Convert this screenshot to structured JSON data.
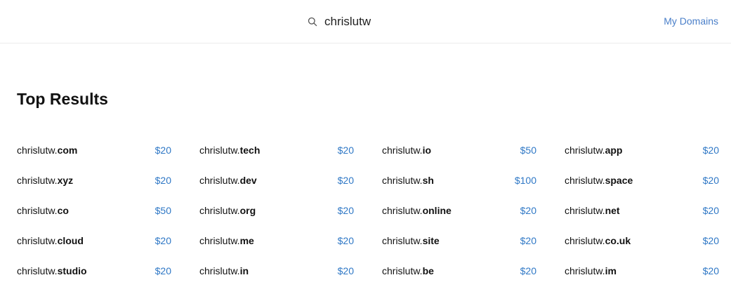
{
  "header": {
    "search_value": "chrislutw",
    "search_icon": "search-icon",
    "my_domains_label": "My Domains",
    "accent_color": "#2f78c6"
  },
  "section": {
    "title": "Top Results"
  },
  "results": [
    {
      "name": "chrislutw.",
      "tld": "com",
      "price": "$20"
    },
    {
      "name": "chrislutw.",
      "tld": "tech",
      "price": "$20"
    },
    {
      "name": "chrislutw.",
      "tld": "io",
      "price": "$50"
    },
    {
      "name": "chrislutw.",
      "tld": "app",
      "price": "$20"
    },
    {
      "name": "chrislutw.",
      "tld": "xyz",
      "price": "$20"
    },
    {
      "name": "chrislutw.",
      "tld": "dev",
      "price": "$20"
    },
    {
      "name": "chrislutw.",
      "tld": "sh",
      "price": "$100"
    },
    {
      "name": "chrislutw.",
      "tld": "space",
      "price": "$20"
    },
    {
      "name": "chrislutw.",
      "tld": "co",
      "price": "$50"
    },
    {
      "name": "chrislutw.",
      "tld": "org",
      "price": "$20"
    },
    {
      "name": "chrislutw.",
      "tld": "online",
      "price": "$20"
    },
    {
      "name": "chrislutw.",
      "tld": "net",
      "price": "$20"
    },
    {
      "name": "chrislutw.",
      "tld": "cloud",
      "price": "$20"
    },
    {
      "name": "chrislutw.",
      "tld": "me",
      "price": "$20"
    },
    {
      "name": "chrislutw.",
      "tld": "site",
      "price": "$20"
    },
    {
      "name": "chrislutw.",
      "tld": "co.uk",
      "price": "$20"
    },
    {
      "name": "chrislutw.",
      "tld": "studio",
      "price": "$20"
    },
    {
      "name": "chrislutw.",
      "tld": "in",
      "price": "$20"
    },
    {
      "name": "chrislutw.",
      "tld": "be",
      "price": "$20"
    },
    {
      "name": "chrislutw.",
      "tld": "im",
      "price": "$20"
    }
  ]
}
